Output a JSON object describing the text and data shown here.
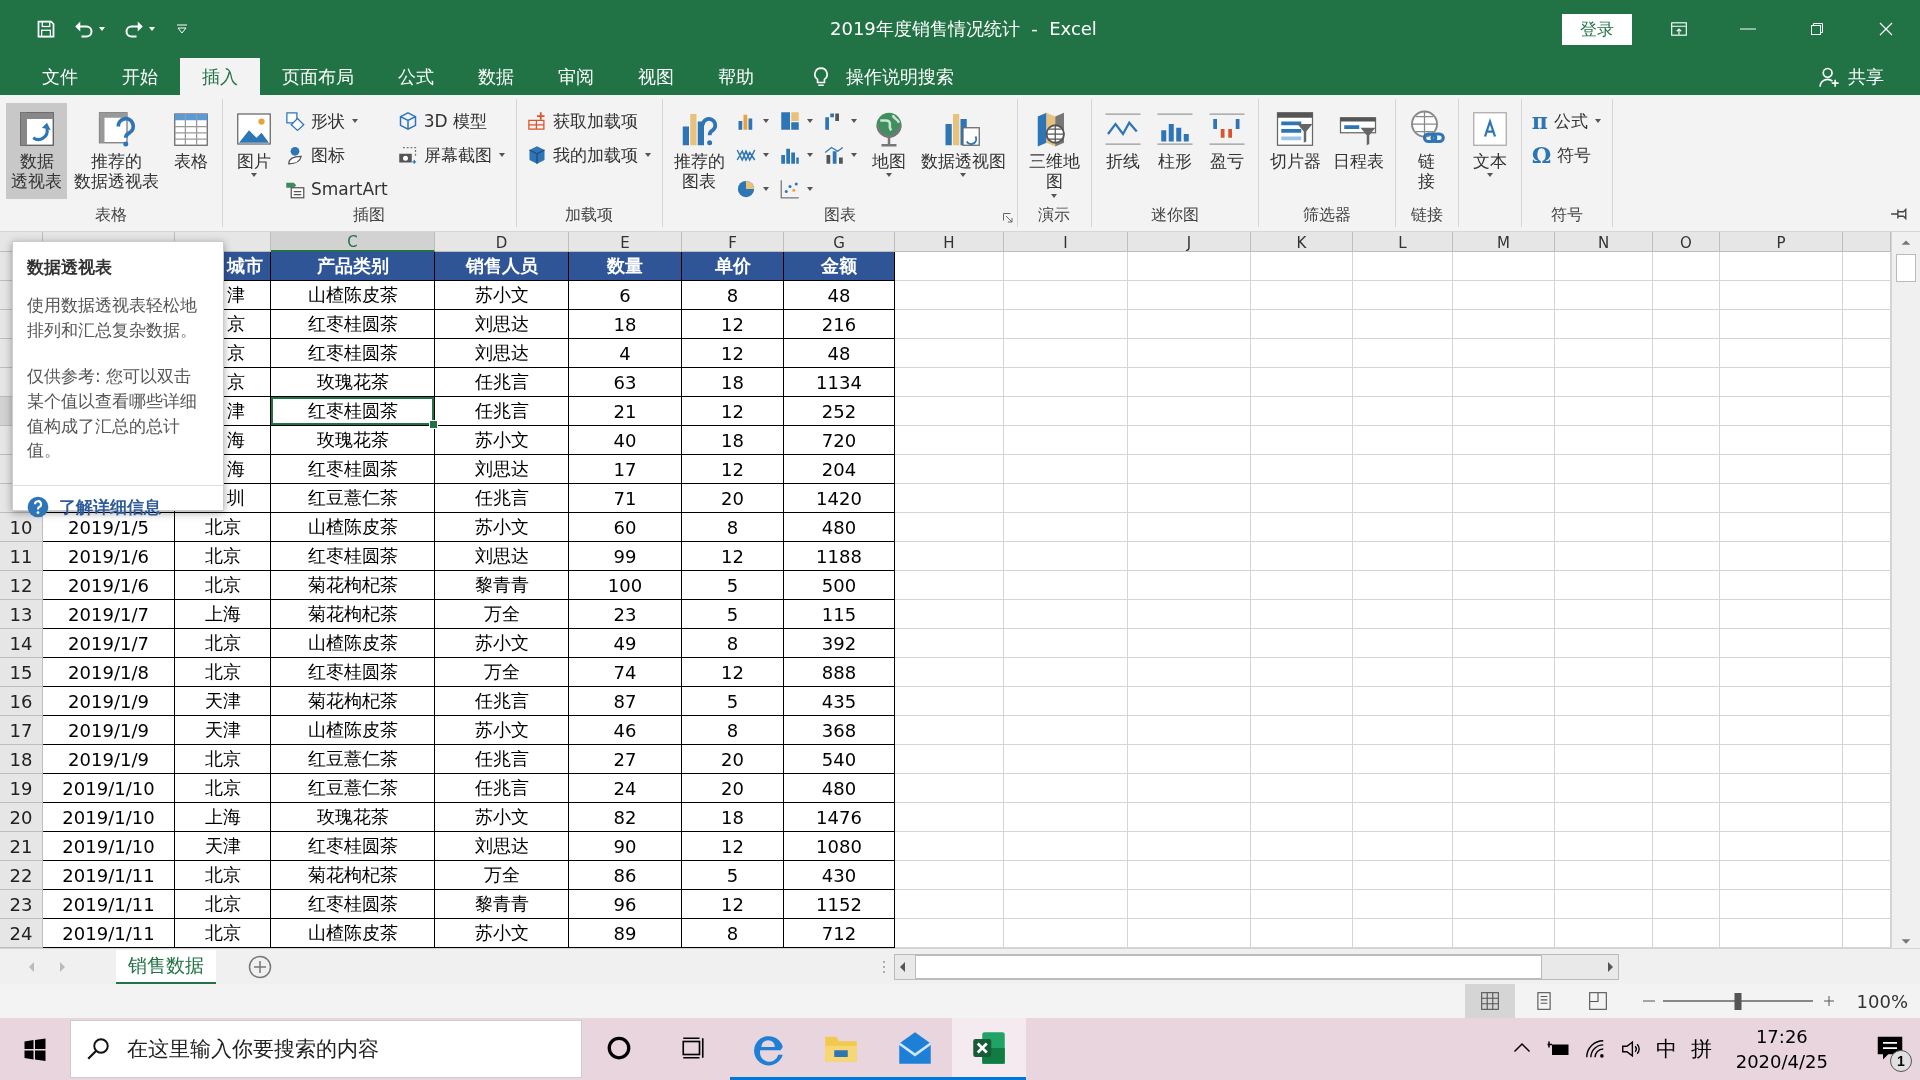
{
  "title_bar": {
    "title": "2019年度销售情况统计  -  Excel",
    "sign_in": "登录"
  },
  "menu": {
    "tabs": [
      {
        "label": "文件",
        "selected": false
      },
      {
        "label": "开始",
        "selected": false
      },
      {
        "label": "插入",
        "selected": true
      },
      {
        "label": "页面布局",
        "selected": false
      },
      {
        "label": "公式",
        "selected": false
      },
      {
        "label": "数据",
        "selected": false
      },
      {
        "label": "审阅",
        "selected": false
      },
      {
        "label": "视图",
        "selected": false
      },
      {
        "label": "帮助",
        "selected": false
      }
    ],
    "tell_me": "操作说明搜索",
    "share": "共享"
  },
  "ribbon": {
    "groups": [
      {
        "label": "表格",
        "items": [
          {
            "kind": "large",
            "label": "数据透视表",
            "selected": true,
            "dropdown": false
          },
          {
            "kind": "large",
            "label": "推荐的数据透视表",
            "selected": false,
            "dropdown": false
          },
          {
            "kind": "large",
            "label": "表格",
            "selected": false,
            "dropdown": false
          }
        ]
      },
      {
        "label": "插图",
        "items": [
          {
            "kind": "large",
            "label": "图片",
            "selected": false,
            "dropdown": true
          },
          {
            "kind": "stack",
            "items": [
              {
                "label": "形状",
                "dropdown": true
              },
              {
                "label": "图标",
                "dropdown": false
              },
              {
                "label": "SmartArt",
                "dropdown": false
              }
            ]
          },
          {
            "kind": "stack",
            "items": [
              {
                "label": "3D 模型",
                "dropdown": false
              },
              {
                "label": "屏幕截图",
                "dropdown": true
              }
            ]
          }
        ]
      },
      {
        "label": "加载项",
        "items": [
          {
            "kind": "stack",
            "items": [
              {
                "label": "获取加载项",
                "dropdown": false
              },
              {
                "label": "我的加载项",
                "dropdown": true
              }
            ]
          }
        ]
      },
      {
        "label": "图表",
        "launcher": true,
        "items": [
          {
            "kind": "large",
            "label": "推荐的图表",
            "selected": false,
            "dropdown": false
          },
          {
            "kind": "stack",
            "items": [
              {
                "dropdown": true
              },
              {
                "dropdown": true
              },
              {
                "dropdown": true
              }
            ]
          },
          {
            "kind": "stack",
            "items": [
              {
                "dropdown": true
              },
              {
                "dropdown": true
              },
              {
                "dropdown": true
              }
            ]
          },
          {
            "kind": "stack",
            "items": [
              {
                "dropdown": true
              },
              {
                "dropdown": true
              }
            ]
          },
          {
            "kind": "large",
            "label": "地图",
            "selected": false,
            "dropdown": true
          },
          {
            "kind": "large",
            "label": "数据透视图",
            "selected": false,
            "dropdown": true
          }
        ]
      },
      {
        "label": "演示",
        "items": [
          {
            "kind": "large",
            "label": "三维地图",
            "selected": false,
            "dropdown": true
          }
        ]
      },
      {
        "label": "迷你图",
        "items": [
          {
            "kind": "large",
            "label": "折线",
            "selected": false,
            "dropdown": false
          },
          {
            "kind": "large",
            "label": "柱形",
            "selected": false,
            "dropdown": false
          },
          {
            "kind": "large",
            "label": "盈亏",
            "selected": false,
            "dropdown": false
          }
        ]
      },
      {
        "label": "筛选器",
        "items": [
          {
            "kind": "large",
            "label": "切片器",
            "selected": false,
            "dropdown": false
          },
          {
            "kind": "large",
            "label": "日程表",
            "selected": false,
            "dropdown": false
          }
        ]
      },
      {
        "label": "链接",
        "items": [
          {
            "kind": "large",
            "label": "链接",
            "selected": false,
            "dropdown": false
          }
        ]
      },
      {
        "items": [
          {
            "kind": "large",
            "label": "文本",
            "selected": false,
            "dropdown": true
          }
        ]
      },
      {
        "label": "符号",
        "items": [
          {
            "kind": "stack",
            "items": [
              {
                "glyph": "π",
                "label": "公式",
                "dropdown": true
              },
              {
                "glyph": "Ω",
                "label": "符号",
                "dropdown": false
              }
            ]
          }
        ]
      }
    ]
  },
  "sheet": {
    "columns": [
      {
        "selected": false
      },
      {
        "selected": false
      },
      {
        "letter": "C",
        "selected": true
      },
      {
        "letter": "D",
        "selected": false
      },
      {
        "letter": "E",
        "selected": false
      },
      {
        "letter": "F",
        "selected": false
      },
      {
        "letter": "G",
        "selected": false
      },
      {
        "letter": "H",
        "selected": false
      },
      {
        "letter": "I",
        "selected": false
      },
      {
        "letter": "J",
        "selected": false
      },
      {
        "letter": "K",
        "selected": false
      },
      {
        "letter": "L",
        "selected": false
      },
      {
        "letter": "M",
        "selected": false
      },
      {
        "letter": "N",
        "selected": false
      },
      {
        "letter": "O",
        "selected": false
      },
      {
        "letter": "P",
        "selected": false
      }
    ],
    "rows": [
      {
        "kind": "header",
        "selected": false,
        "cells": [
          "城市",
          "产品类别",
          "销售人员",
          "数量",
          "单价",
          "金额"
        ]
      },
      {
        "kind": "data",
        "selected": false,
        "cells": [
          "津",
          "山楂陈皮茶",
          "苏小文",
          "6",
          "8",
          "48"
        ]
      },
      {
        "kind": "data",
        "selected": false,
        "cells": [
          "京",
          "红枣桂圆茶",
          "刘思达",
          "18",
          "12",
          "216"
        ]
      },
      {
        "kind": "data",
        "selected": false,
        "cells": [
          "京",
          "红枣桂圆茶",
          "刘思达",
          "4",
          "12",
          "48"
        ]
      },
      {
        "kind": "data",
        "selected": false,
        "cells": [
          "京",
          "玫瑰花茶",
          "任兆言",
          "63",
          "18",
          "1134"
        ]
      },
      {
        "kind": "data",
        "selected": true,
        "cells": [
          "津",
          "红枣桂圆茶",
          "任兆言",
          "21",
          "12",
          "252"
        ]
      },
      {
        "kind": "data",
        "selected": false,
        "cells": [
          "海",
          "玫瑰花茶",
          "苏小文",
          "40",
          "18",
          "720"
        ]
      },
      {
        "kind": "data",
        "selected": false,
        "cells": [
          "海",
          "红枣桂圆茶",
          "刘思达",
          "17",
          "12",
          "204"
        ]
      },
      {
        "kind": "data",
        "selected": false,
        "cells": [
          "圳",
          "红豆薏仁茶",
          "任兆言",
          "71",
          "20",
          "1420"
        ]
      },
      {
        "kind": "data",
        "selected": false,
        "number": "10",
        "cells": [
          "2019/1/5",
          "北京",
          "山楂陈皮茶",
          "苏小文",
          "60",
          "8",
          "480"
        ]
      },
      {
        "kind": "data",
        "selected": false,
        "number": "11",
        "cells": [
          "2019/1/6",
          "北京",
          "红枣桂圆茶",
          "刘思达",
          "99",
          "12",
          "1188"
        ]
      },
      {
        "kind": "data",
        "selected": false,
        "number": "12",
        "cells": [
          "2019/1/6",
          "北京",
          "菊花枸杞茶",
          "黎青青",
          "100",
          "5",
          "500"
        ]
      },
      {
        "kind": "data",
        "selected": false,
        "number": "13",
        "cells": [
          "2019/1/7",
          "上海",
          "菊花枸杞茶",
          "万全",
          "23",
          "5",
          "115"
        ]
      },
      {
        "kind": "data",
        "selected": false,
        "number": "14",
        "cells": [
          "2019/1/7",
          "北京",
          "山楂陈皮茶",
          "苏小文",
          "49",
          "8",
          "392"
        ]
      },
      {
        "kind": "data",
        "selected": false,
        "number": "15",
        "cells": [
          "2019/1/8",
          "北京",
          "红枣桂圆茶",
          "万全",
          "74",
          "12",
          "888"
        ]
      },
      {
        "kind": "data",
        "selected": false,
        "number": "16",
        "cells": [
          "2019/1/9",
          "天津",
          "菊花枸杞茶",
          "任兆言",
          "87",
          "5",
          "435"
        ]
      },
      {
        "kind": "data",
        "selected": false,
        "number": "17",
        "cells": [
          "2019/1/9",
          "天津",
          "山楂陈皮茶",
          "苏小文",
          "46",
          "8",
          "368"
        ]
      },
      {
        "kind": "data",
        "selected": false,
        "number": "18",
        "cells": [
          "2019/1/9",
          "北京",
          "红豆薏仁茶",
          "任兆言",
          "27",
          "20",
          "540"
        ]
      },
      {
        "kind": "data",
        "selected": false,
        "number": "19",
        "cells": [
          "2019/1/10",
          "北京",
          "红豆薏仁茶",
          "任兆言",
          "24",
          "20",
          "480"
        ]
      },
      {
        "kind": "data",
        "selected": false,
        "number": "20",
        "cells": [
          "2019/1/10",
          "上海",
          "玫瑰花茶",
          "苏小文",
          "82",
          "18",
          "1476"
        ]
      },
      {
        "kind": "data",
        "selected": false,
        "number": "21",
        "cells": [
          "2019/1/10",
          "天津",
          "红枣桂圆茶",
          "刘思达",
          "90",
          "12",
          "1080"
        ]
      },
      {
        "kind": "data",
        "selected": false,
        "number": "22",
        "cells": [
          "2019/1/11",
          "北京",
          "菊花枸杞茶",
          "万全",
          "86",
          "5",
          "430"
        ]
      },
      {
        "kind": "data",
        "selected": false,
        "number": "23",
        "cells": [
          "2019/1/11",
          "北京",
          "红枣桂圆茶",
          "黎青青",
          "96",
          "12",
          "1152"
        ]
      },
      {
        "kind": "data",
        "selected": false,
        "number": "24",
        "cells": [
          "2019/1/11",
          "北京",
          "山楂陈皮茶",
          "苏小文",
          "89",
          "8",
          "712"
        ]
      }
    ]
  },
  "tooltip": {
    "title": "数据透视表",
    "paragraphs": [
      "使用数据透视表轻松地排列和汇总复杂数据。",
      "仅供参考: 您可以双击某个值以查看哪些详细值构成了汇总的总计值。"
    ],
    "link": "了解详细信息"
  },
  "sheet_tabs": [
    {
      "label": "销售数据",
      "selected": true
    }
  ],
  "status_bar": {
    "views": [
      {
        "selected": true
      },
      {
        "selected": false
      },
      {
        "selected": false
      }
    ],
    "zoom": {
      "level": 0.5,
      "reading": "100%"
    }
  },
  "taskbar": {
    "search": {
      "placeholder": "在这里输入你要搜索的内容"
    },
    "apps": [
      {
        "kind": "cortana",
        "running": false,
        "selected": false
      },
      {
        "kind": "task_view",
        "running": false,
        "selected": false
      },
      {
        "kind": "edge",
        "running": true,
        "selected": false
      },
      {
        "kind": "explorer",
        "running": true,
        "selected": false
      },
      {
        "kind": "mail",
        "running": true,
        "selected": false
      },
      {
        "kind": "excel",
        "running": true,
        "selected": true
      }
    ],
    "input_mode": "中",
    "ime": "拼",
    "time": "17:26",
    "date": "2020/4/25",
    "notifications": "1"
  }
}
